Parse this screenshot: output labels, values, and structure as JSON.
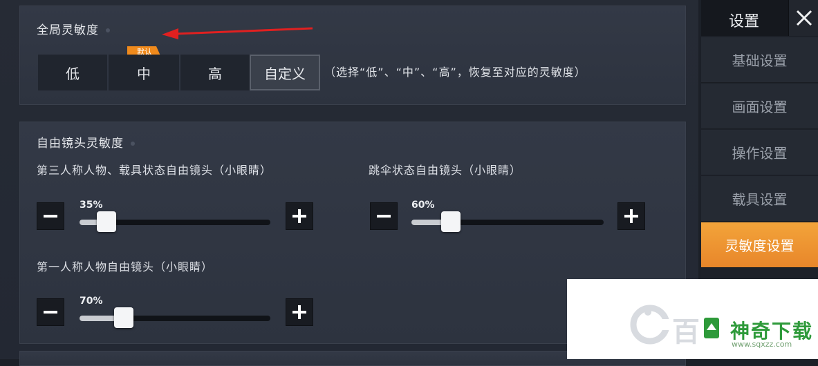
{
  "global": {
    "title": "全局灵敏度",
    "badge": "默认",
    "options": [
      "低",
      "中",
      "高",
      "自定义"
    ],
    "selected": "自定义",
    "hint": "（选择“低”、“中”、“高”，恢复至对应的灵敏度）"
  },
  "free_camera": {
    "title": "自由镜头灵敏度",
    "sliders": [
      {
        "label": "第三人称人物、载具状态自由镜头（小眼睛）",
        "value_text": "35%",
        "value": 35
      },
      {
        "label": "跳伞状态自由镜头（小眼睛）",
        "value_text": "60%",
        "value": 60
      },
      {
        "label": "第一人称人物自由镜头（小眼睛）",
        "value_text": "70%",
        "value": 70
      }
    ]
  },
  "sidebar": {
    "title": "设置",
    "close_icon": "close-icon",
    "items": [
      {
        "label": "基础设置",
        "active": false
      },
      {
        "label": "画面设置",
        "active": false
      },
      {
        "label": "操作设置",
        "active": false
      },
      {
        "label": "载具设置",
        "active": false
      },
      {
        "label": "灵敏度设置",
        "active": true
      }
    ],
    "accent": "#F0962C"
  },
  "watermark": {
    "brand": "神奇下载",
    "url": "www.sqxzz.com"
  }
}
